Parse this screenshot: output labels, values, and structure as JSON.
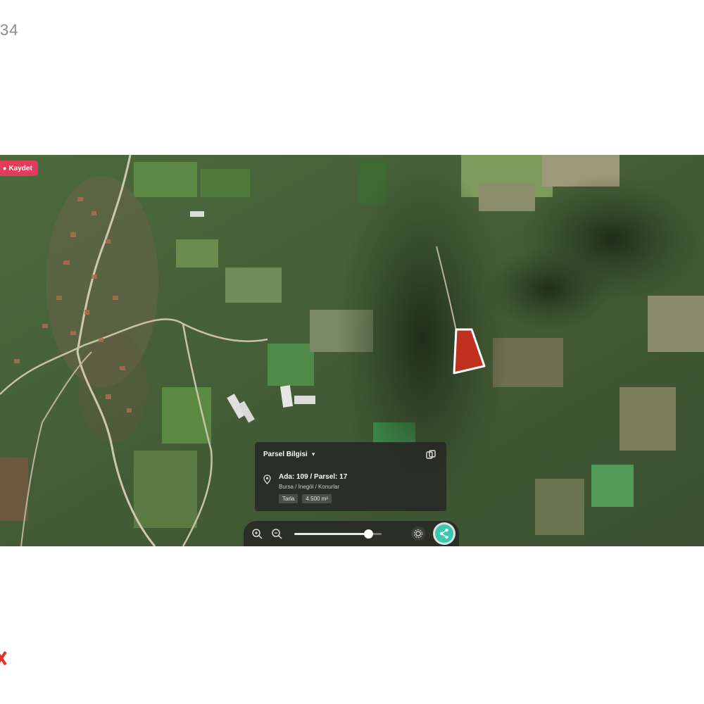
{
  "page": {
    "corner_text": "34"
  },
  "map": {
    "badge_label": "Kaydet",
    "info_panel": {
      "header_label": "Parsel Bilgisi",
      "parcel_title": "Ada: 109 / Parsel: 17",
      "location": "Bursa / İnegöl / Konurlar",
      "tags": [
        "Tarla",
        "4.500 m²"
      ]
    },
    "zoom_level_fraction": 0.85,
    "colors": {
      "accent_badge": "#e23c5a",
      "parcel_fill": "#c0301f",
      "share_button": "#39c7b0"
    },
    "icons": [
      "copy-icon",
      "pin-icon",
      "zoom-in-icon",
      "zoom-out-icon",
      "settings-icon",
      "share-icon",
      "chevron-down-icon"
    ]
  }
}
